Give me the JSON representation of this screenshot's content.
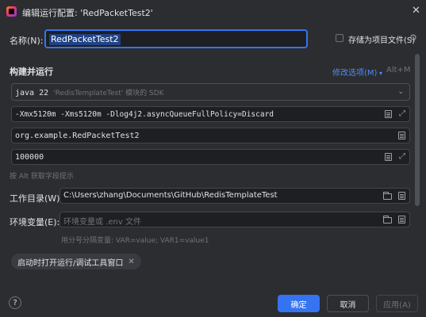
{
  "window": {
    "title": "编辑运行配置: 'RedPacketTest2'"
  },
  "name_row": {
    "label": "名称(N):",
    "value": "RedPacketTest2",
    "store_as_project_file": "存储为项目文件(S)"
  },
  "build_run": {
    "section_title": "构建并运行",
    "modify_options": "修改选项(M)",
    "modify_shortcut": "Alt+M",
    "jdk": "java 22",
    "jdk_hint": "'RedisTemplateTest' 模块的 SDK",
    "vm_options": "-Xmx5120m -Xms5120m -Dlog4j2.asyncQueueFullPolicy=Discard",
    "main_class": "org.example.RedPacketTest2",
    "program_args": "100000",
    "alt_hint": "按 Alt 获取字段提示"
  },
  "working_dir": {
    "label": "工作目录(W):",
    "value": "C:\\Users\\zhang\\Documents\\GitHub\\RedisTemplateTest"
  },
  "env": {
    "label": "环境变量(E):",
    "placeholder": "环境变量或 .env 文件",
    "hint": "用分号分隔变量: VAR=value; VAR1=value1"
  },
  "chip": {
    "label": "启动时打开运行/调试工具窗口"
  },
  "footer": {
    "help": "?",
    "ok": "确定",
    "cancel": "取消",
    "apply": "应用(A)"
  },
  "colors": {
    "background": "#2b2d30",
    "field_background": "#1e1f22",
    "accent": "#3574f0",
    "link": "#548af7"
  }
}
